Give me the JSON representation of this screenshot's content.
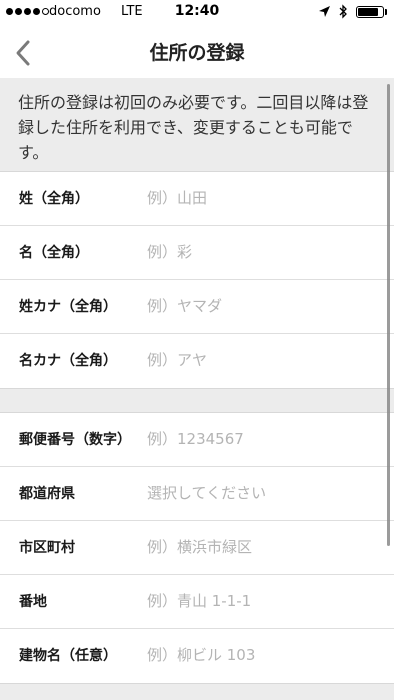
{
  "status_bar": {
    "carrier": "docomo",
    "network": "LTE",
    "time": "12:40",
    "signal_bars_filled": 4,
    "signal_bars_total": 5,
    "battery_level": 0.9,
    "icons": [
      "location-arrow-icon",
      "bluetooth-icon",
      "battery-icon"
    ]
  },
  "nav": {
    "title": "住所の登録",
    "back_icon": "chevron-left-icon"
  },
  "info": {
    "text": "住所の登録は初回のみ必要です。二回目以降は登録した住所を利用でき、変更することも可能です。"
  },
  "name_section": [
    {
      "label": "姓（全角）",
      "placeholder": "例）山田",
      "value": ""
    },
    {
      "label": "名（全角）",
      "placeholder": "例）彩",
      "value": ""
    },
    {
      "label": "姓カナ（全角）",
      "placeholder": "例）ヤマダ",
      "value": ""
    },
    {
      "label": "名カナ（全角）",
      "placeholder": "例）アヤ",
      "value": ""
    }
  ],
  "address_section": [
    {
      "label": "郵便番号（数字）",
      "placeholder": "例）1234567",
      "value": ""
    },
    {
      "label": "都道府県",
      "placeholder": "選択してください",
      "value": ""
    },
    {
      "label": "市区町村",
      "placeholder": "例）横浜市緑区",
      "value": ""
    },
    {
      "label": "番地",
      "placeholder": "例）青山 1-1-1",
      "value": ""
    },
    {
      "label": "建物名（任意）",
      "placeholder": "例）柳ビル 103",
      "value": ""
    }
  ],
  "colors": {
    "banner_bg": "#ececec",
    "label": "#1a1a1a",
    "placeholder": "#b4b4b4",
    "divider": "#dedede"
  }
}
